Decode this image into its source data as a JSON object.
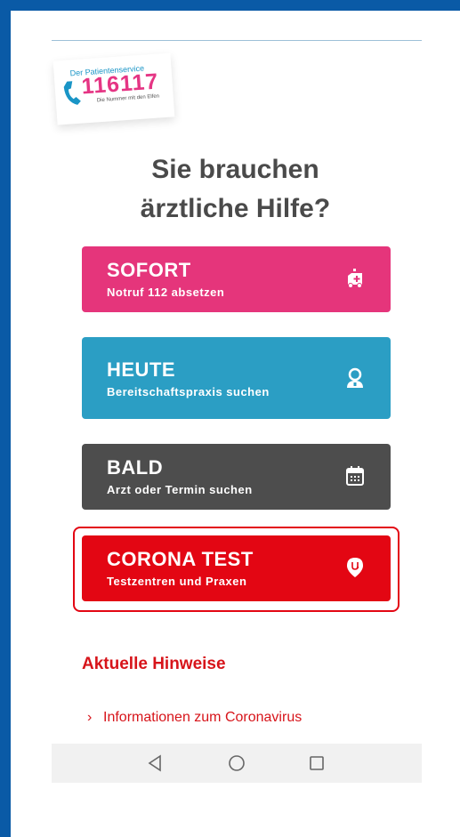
{
  "logo": {
    "line1": "Der Patientenservice",
    "number": "116117",
    "line3": "Die Nummer mit den Elfen"
  },
  "heading": {
    "line1": "Sie brauchen",
    "line2": "ärztliche Hilfe?"
  },
  "buttons": [
    {
      "title": "SOFORT",
      "subtitle": "Notruf 112 absetzen",
      "icon": "ambulance-icon",
      "color": "#e5357b"
    },
    {
      "title": "HEUTE",
      "subtitle": "Bereitschaftspraxis suchen",
      "icon": "doctor-icon",
      "color": "#2b9ec4"
    },
    {
      "title": "BALD",
      "subtitle": "Arzt oder Termin suchen",
      "icon": "calendar-icon",
      "color": "#4d4d4d"
    },
    {
      "title": "CORONA TEST",
      "subtitle": "Testzentren und Praxen",
      "icon": "location-pin-icon",
      "color": "#e30613"
    }
  ],
  "notices": {
    "heading": "Aktuelle Hinweise",
    "items": [
      {
        "label": "Informationen zum Coronavirus"
      }
    ]
  },
  "navbar": {
    "icons": [
      "back-icon",
      "home-icon",
      "recent-apps-icon"
    ]
  }
}
